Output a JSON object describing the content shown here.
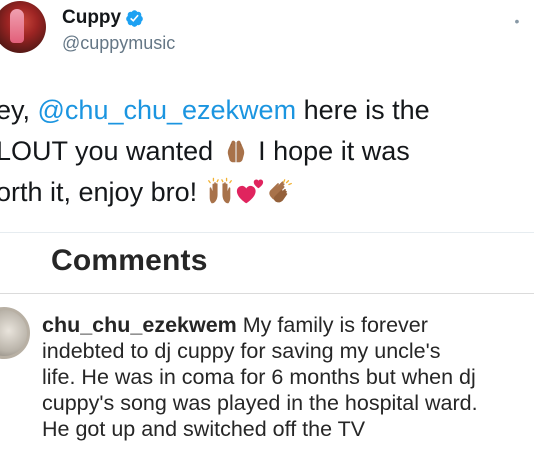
{
  "tweet": {
    "display_name": "Cuppy",
    "handle": "@cuppymusic",
    "verified": true,
    "more_glyph": "•",
    "text": {
      "line1_prefix": "ey, ",
      "line1_mention": "@chu_chu_ezekwem",
      "line1_suffix": " here is the",
      "line2_prefix": "LOUT you wanted ",
      "line2_suffix": " I hope it was",
      "line3_prefix": "orth it, enjoy bro! "
    },
    "emojis": [
      "praying-hands-emoji",
      "raising-hands-emoji",
      "two-hearts-emoji",
      "clapping-hands-emoji"
    ]
  },
  "comments": {
    "title": "Comments",
    "items": [
      {
        "username": "chu_chu_ezekwem",
        "lines": [
          " My family is forever",
          "indebted to dj cuppy for saving my uncle's",
          "life. He was in coma for 6 months but when dj",
          "cuppy's song was played in the hospital ward.",
          "He got up and switched off the TV"
        ]
      }
    ]
  },
  "colors": {
    "mention": "#1b95e0",
    "verified": "#1da1f2",
    "handle": "#657786",
    "text": "#14171a",
    "skin": "#a8724a",
    "heart": "#e0245e"
  }
}
